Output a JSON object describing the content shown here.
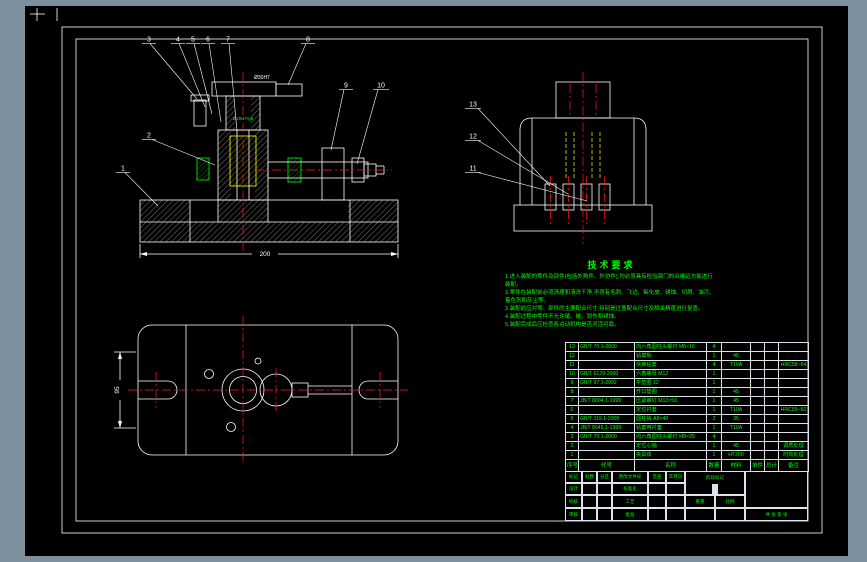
{
  "colors": {
    "viewport_background": "#7e8f9e",
    "sheet": "#000000",
    "line": "#ffffff",
    "centerline": "#ff1a1a",
    "highlight": "#ffff00",
    "annotation_green": "#00ff00"
  },
  "views": {
    "front": {
      "balloons": [
        "1",
        "2",
        "3",
        "4",
        "5",
        "6",
        "7",
        "8",
        "9",
        "10"
      ],
      "dims": {
        "width": "200",
        "bore": "Ø30H7",
        "fit": "Ø20H7/g6"
      }
    },
    "side": {
      "balloons": [
        "11",
        "12",
        "13"
      ]
    },
    "plan": {
      "dims": {
        "height": "95"
      }
    }
  },
  "tech_requirements": {
    "title": "技术要求",
    "lines": [
      "1.进入装配的零件及部件(包括外购件、外协件),均必须具有检验部门的合格证方能进行装配。",
      "2.零件在装配前必须清理和清洗干净,不得有毛刺、飞边、氧化皮、锈蚀、切屑、油污、着色剂和灰尘等。",
      "3.装配前应对零、部件的主要配合尺寸,特别是过盈配合尺寸及相关精度进行复查。",
      "4.装配过程中零件不允许磕、碰、划伤和锈蚀。",
      "5.装配完成后应检查各运动机构是否灵活可靠。"
    ]
  },
  "bom": {
    "headers": {
      "no": "序号",
      "code": "代号",
      "name": "名称",
      "qty": "数量",
      "material": "材料",
      "unit": "单件",
      "total": "总计",
      "remark": "备注"
    },
    "rows": [
      {
        "no": "13",
        "code": "GB/T 70.1-2000",
        "name": "内六角圆柱头螺钉 M6×16",
        "qty": "4",
        "material": "",
        "unit": "",
        "total": "",
        "remark": ""
      },
      {
        "no": "12",
        "code": "",
        "name": "钻模板",
        "qty": "1",
        "material": "45",
        "unit": "",
        "total": "",
        "remark": ""
      },
      {
        "no": "11",
        "code": "",
        "name": "快换钻套",
        "qty": "4",
        "material": "T10A",
        "unit": "",
        "total": "",
        "remark": "HRC58~64"
      },
      {
        "no": "10",
        "code": "GB/T 6170-2000",
        "name": "六角螺母 M12",
        "qty": "1",
        "material": "",
        "unit": "",
        "total": "",
        "remark": ""
      },
      {
        "no": "9",
        "code": "GB/T 97.1-2002",
        "name": "平垫圈 12",
        "qty": "1",
        "material": "",
        "unit": "",
        "total": "",
        "remark": ""
      },
      {
        "no": "8",
        "code": "",
        "name": "开口垫圈",
        "qty": "1",
        "material": "45",
        "unit": "",
        "total": "",
        "remark": ""
      },
      {
        "no": "7",
        "code": "JB/T 8004.1-1999",
        "name": "压紧螺钉 M12×50",
        "qty": "1",
        "material": "45",
        "unit": "",
        "total": "",
        "remark": ""
      },
      {
        "no": "6",
        "code": "",
        "name": "定位衬套",
        "qty": "1",
        "material": "T10A",
        "unit": "",
        "total": "",
        "remark": "HRC55~60"
      },
      {
        "no": "5",
        "code": "GB/T 119.1-2000",
        "name": "圆柱销 A8×40",
        "qty": "2",
        "material": "35",
        "unit": "",
        "total": "",
        "remark": ""
      },
      {
        "no": "4",
        "code": "JB/T 8045.1-1999",
        "name": "钻套用衬套",
        "qty": "1",
        "material": "T10A",
        "unit": "",
        "total": "",
        "remark": ""
      },
      {
        "no": "3",
        "code": "GB/T 70.1-2000",
        "name": "内六角圆柱头螺钉 M8×25",
        "qty": "4",
        "material": "",
        "unit": "",
        "total": "",
        "remark": ""
      },
      {
        "no": "2",
        "code": "",
        "name": "定位心轴",
        "qty": "1",
        "material": "45",
        "unit": "",
        "total": "",
        "remark": "调质处理"
      },
      {
        "no": "1",
        "code": "",
        "name": "夹具体",
        "qty": "1",
        "material": "HT200",
        "unit": "",
        "total": "",
        "remark": "时效处理"
      }
    ]
  },
  "title_block": {
    "mark": "标记",
    "count": "处数",
    "zone": "分区",
    "change_doc": "更改文件号",
    "sign": "签名",
    "date": "年月日",
    "design": "设计",
    "check": "校核",
    "audit": "审核",
    "standard": "标准化",
    "process": "工艺",
    "approve": "批准",
    "stage": "阶段标记",
    "weight": "重量",
    "scale": "比例",
    "sheets": "共 张 第 张"
  }
}
